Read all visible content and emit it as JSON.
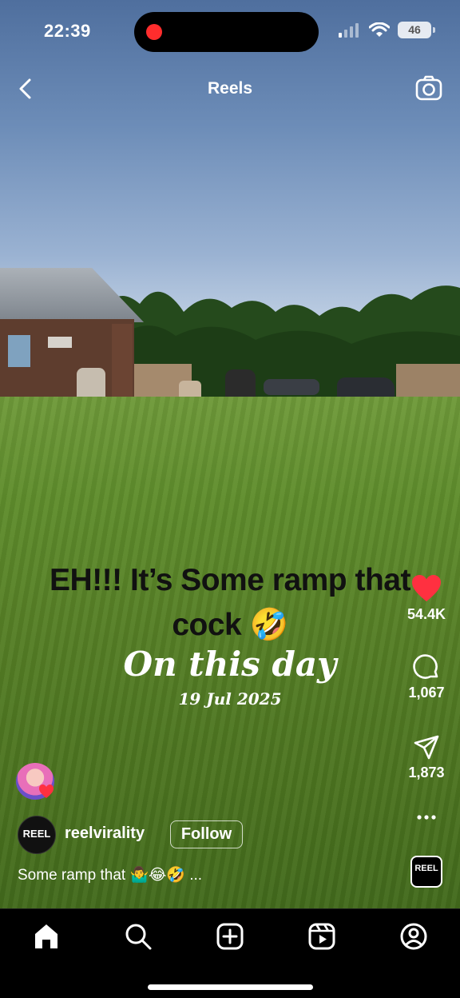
{
  "status_bar": {
    "time": "22:39",
    "battery": "46"
  },
  "header": {
    "title": "Reels"
  },
  "overlay": {
    "line1": "EH!!! It’s Some ramp that",
    "line2": "cock 🤣",
    "on_this_day": "On this day",
    "date": "19 Jul 2025"
  },
  "actions": {
    "likes": "54.4K",
    "comments": "1,067",
    "shares": "1,873",
    "more": "..."
  },
  "post": {
    "avatar_text": "REEL",
    "username": "reelvirality",
    "follow_label": "Follow",
    "caption": "Some ramp that 🤷‍♂️😂🤣 ...",
    "audio_text": "REEL"
  },
  "colors": {
    "like": "#ff3040",
    "background": "#000000",
    "text": "#ffffff"
  },
  "icons": {
    "back": "chevron-left-icon",
    "camera": "camera-icon",
    "like": "heart-icon",
    "comment": "comment-icon",
    "share": "send-icon",
    "more": "more-icon",
    "tabs": [
      "home-icon",
      "search-icon",
      "create-icon",
      "reels-icon",
      "profile-icon"
    ]
  }
}
